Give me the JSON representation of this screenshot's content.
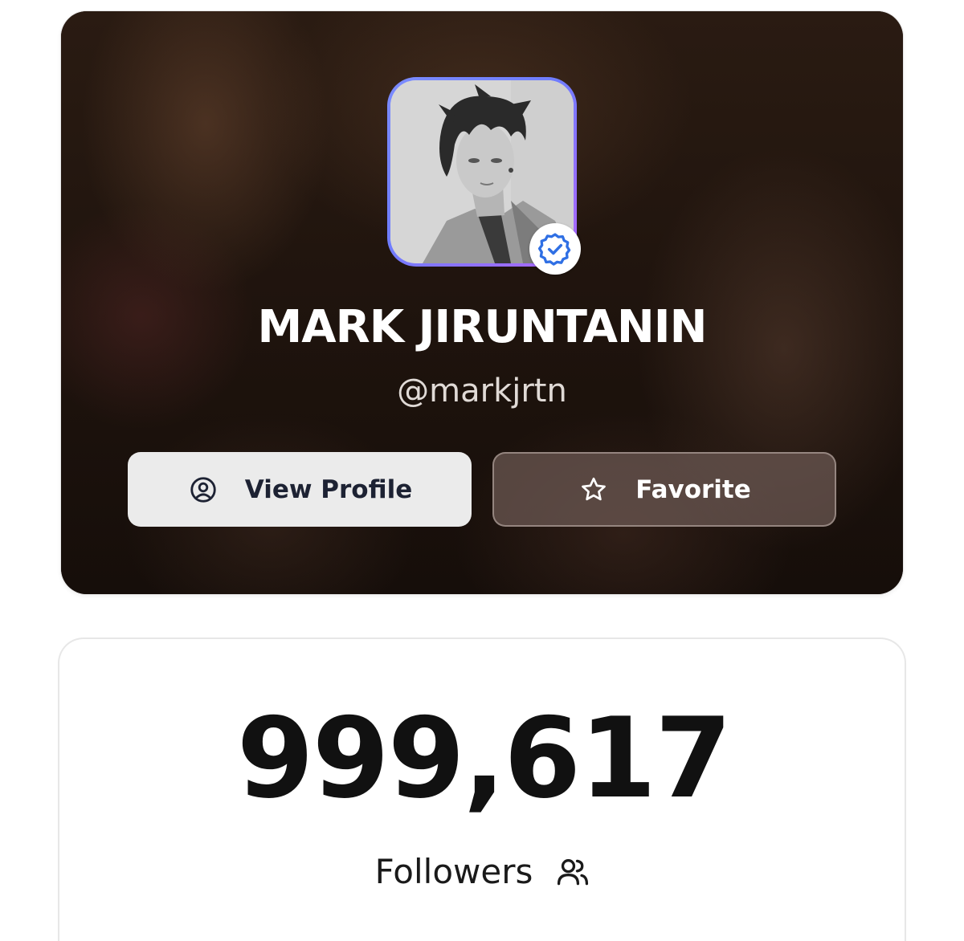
{
  "profile": {
    "name": "MARK JIRUNTANIN",
    "handle": "@markjrtn",
    "avatar_alt": "MARK JIRUNTANIN avatar",
    "verified": true
  },
  "actions": {
    "view_profile_label": "View Profile",
    "favorite_label": "Favorite"
  },
  "stats": {
    "followers_count": "999,617",
    "followers_label": "Followers"
  },
  "icons": {
    "verified": "verified-badge-icon",
    "view_profile": "user-circle-icon",
    "favorite": "star-icon",
    "followers": "users-icon"
  },
  "colors": {
    "avatar_border_start": "#6f7dff",
    "avatar_border_end": "#b066ff",
    "verified_blue": "#2f6fe4",
    "view_button_bg": "#ebebeb",
    "favorite_button_bg": "#6e5a54"
  }
}
